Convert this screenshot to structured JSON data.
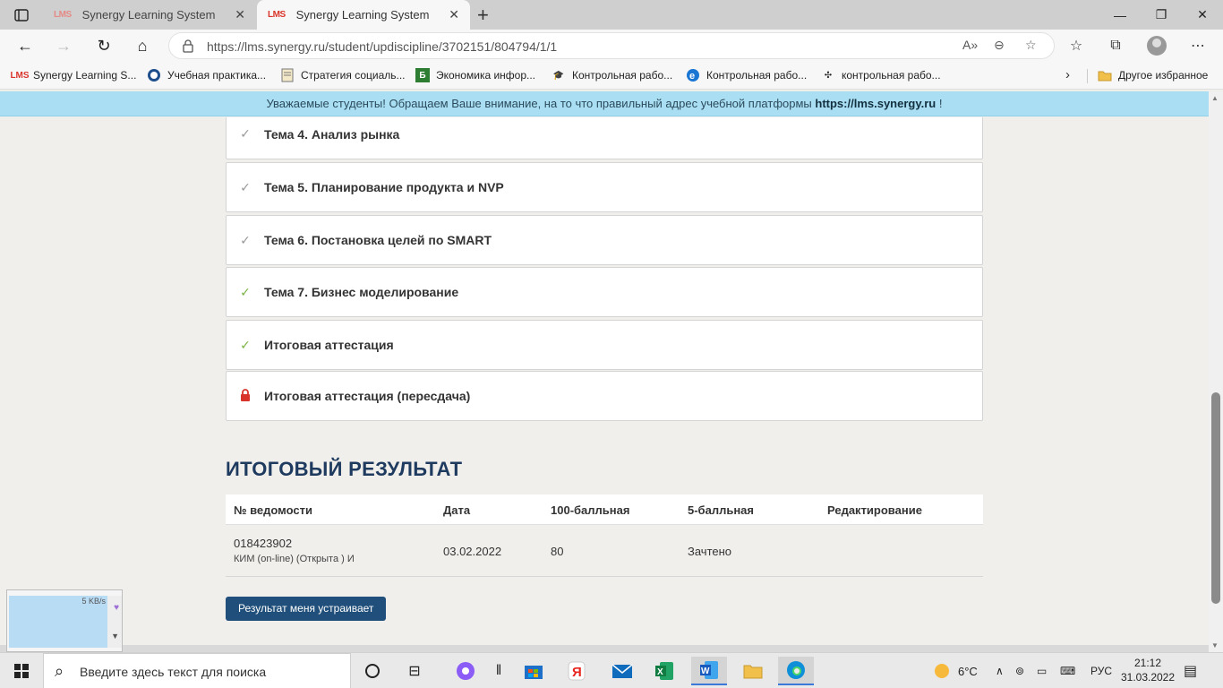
{
  "browser": {
    "tabs": [
      {
        "favicon": "LMS",
        "title": "Synergy Learning System",
        "active": false
      },
      {
        "favicon": "LMS",
        "title": "Synergy Learning System",
        "active": true
      }
    ],
    "new_tab_label": "+",
    "url": "https://lms.synergy.ru/student/updiscipline/3702151/804794/1/1",
    "bookmarks": [
      {
        "icon": "LMS",
        "label": "Synergy Learning S..."
      },
      {
        "icon": "compass-icon",
        "label": "Учебная практика..."
      },
      {
        "icon": "doc-icon",
        "label": "Стратегия социаль..."
      },
      {
        "icon": "Б",
        "label": "Экономика инфор..."
      },
      {
        "icon": "cap-icon",
        "label": "Контрольная рабо..."
      },
      {
        "icon": "e-icon",
        "label": "Контрольная рабо..."
      },
      {
        "icon": "bird-icon",
        "label": "контрольная рабо..."
      }
    ],
    "other_bookmarks": "Другое избранное"
  },
  "notice": {
    "text": "Уважаемые студенты! Обращаем Ваше внимание, на то что правильный адрес учебной платформы",
    "link": "https://lms.synergy.ru",
    "suffix": " !"
  },
  "topics": [
    {
      "label": "Тема 4. Анализ рынка",
      "status": "done-gray"
    },
    {
      "label": "Тема 5. Планирование продукта и NVP",
      "status": "done-gray"
    },
    {
      "label": "Тема 6. Постановка целей по SMART",
      "status": "done-gray"
    },
    {
      "label": "Тема 7. Бизнес моделирование",
      "status": "done-green"
    },
    {
      "label": "Итоговая аттестация",
      "status": "done-green"
    },
    {
      "label": "Итоговая аттестация (пересдача)",
      "status": "locked"
    }
  ],
  "result": {
    "title": "ИТОГОВЫЙ РЕЗУЛЬТАТ",
    "columns": [
      "№ ведомости",
      "Дата",
      "100-балльная",
      "5-балльная",
      "Редактирование"
    ],
    "rows": [
      {
        "number": "018423902",
        "subtitle": "КИМ (on-line) (Открыта ) И",
        "date": "03.02.2022",
        "score100": "80",
        "score5": "Зачтено",
        "edit": ""
      }
    ],
    "accept_button": "Результат меня устраивает"
  },
  "netwidget": {
    "speed": "5 KB/s"
  },
  "taskbar": {
    "search_placeholder": "Введите здесь текст для поиска",
    "weather": "6°C",
    "language": "РУС",
    "time": "21:12",
    "date": "31.03.2022"
  },
  "colors": {
    "accent": "#1f4f7a",
    "title": "#1e3a5f",
    "notice_bg": "#aadff3",
    "check_green": "#7cb342",
    "lock_red": "#d9342b"
  }
}
